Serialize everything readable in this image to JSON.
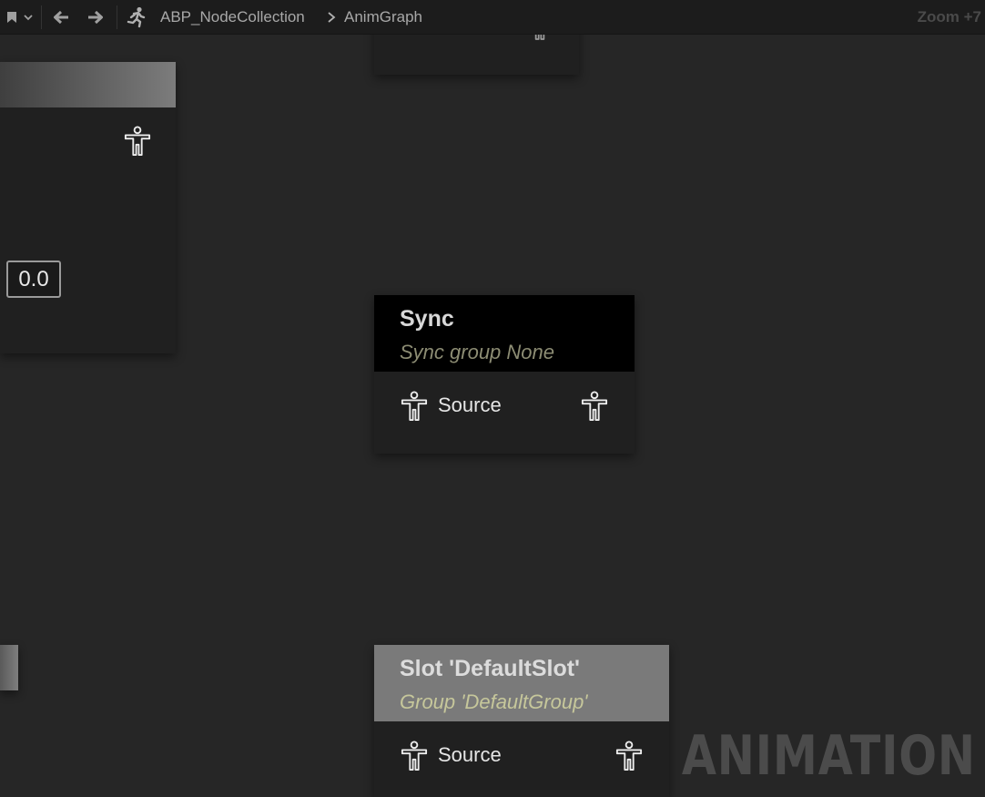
{
  "toolbar": {
    "breadcrumb_root": "ABP_NodeCollection",
    "breadcrumb_current": "AnimGraph",
    "zoom_label": "Zoom +7"
  },
  "nodes": {
    "left_node": {
      "value": "0.0"
    },
    "sync_node": {
      "title": "Sync",
      "subtitle": "Sync group None",
      "pin_label": "Source"
    },
    "slot_node": {
      "title": "Slot 'DefaultSlot'",
      "subtitle": "Group 'DefaultGroup'",
      "pin_label": "Source"
    }
  },
  "watermark": "ANIMATION",
  "colors": {
    "canvas": "#262626",
    "node_body": "#202020",
    "sync_header": "#000000",
    "slot_header": "#7a7a7a",
    "sync_subtitle": "#8c8c73",
    "slot_subtitle": "#c6c79b"
  },
  "icons": [
    "bookmark-icon",
    "chevron-down-icon",
    "arrow-left-icon",
    "arrow-right-icon",
    "running-man-icon",
    "chevron-right-icon",
    "pose-pin-icon"
  ]
}
